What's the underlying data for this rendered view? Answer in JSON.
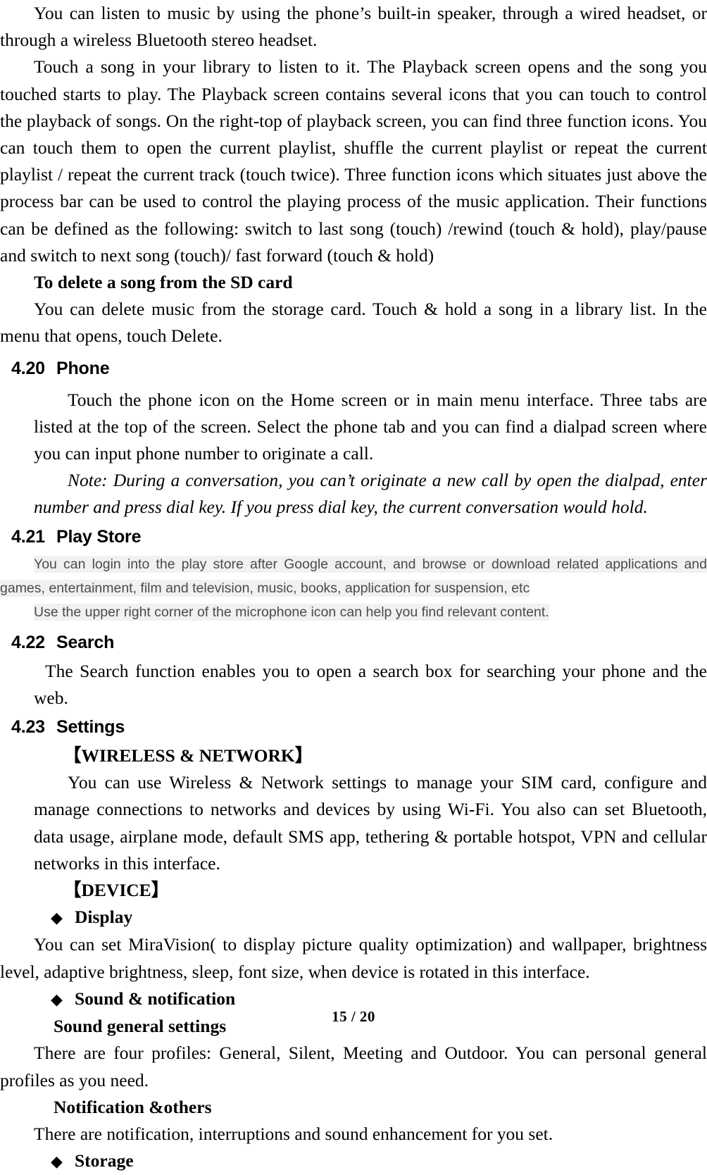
{
  "document": {
    "page_label": "15 / 20",
    "page_number": "15",
    "total_pages": "20"
  },
  "body": {
    "music_para_1": "You can listen to music by using the phone’s built-in speaker, through a wired headset, or through a wireless Bluetooth stereo headset.",
    "music_para_2": "Touch a song in your library to listen to it. The Playback screen opens and the song you touched starts to play. The Playback screen contains several icons that you can touch to control the playback of songs. On the right-top of playback screen, you can find three function icons. You can touch them to open the current playlist, shuffle the current playlist or repeat the current playlist / repeat the current track (touch twice). Three function icons which situates just above the process bar can be used to control the playing process of the music application. Their functions can be defined as the following: switch to last song (touch) /rewind (touch & hold), play/pause and switch to next song (touch)/ fast forward (touch & hold)",
    "delete_song_heading": "To delete a song from the SD card",
    "delete_song_para": "You can delete music from the storage card. Touch & hold a song in a library list. In the menu that opens, touch Delete."
  },
  "sections": [
    {
      "number": "4.20",
      "title": "Phone",
      "paragraph": "Touch the phone icon on the Home screen or in main menu interface. Three tabs are listed at the top of the screen. Select the phone tab and you can find a dialpad screen where you can input phone number to originate a call.",
      "note": "Note: During a conversation, you can’t originate a new call by open the dialpad, enter number and press dial key. If you press dial key, the current conversation would hold."
    },
    {
      "number": "4.21",
      "title": "Play Store",
      "paragraph_1": "You can login into the play store after Google account, and browse or download related applications and games, entertainment, film and television, music, books, application for suspension, etc",
      "paragraph_2": "Use the upper right corner of the microphone icon can help you find relevant content.",
      "highlight_color": "#f1f1f1",
      "text_color": "#4a4a4a"
    },
    {
      "number": "4.22",
      "title": "Search",
      "paragraph": "The Search function enables you to open a search box for searching your phone and the web."
    },
    {
      "number": "4.23",
      "title": "Settings",
      "wireless_heading": "【WIRELESS & NETWORK】",
      "wireless_para": "You can use Wireless & Network settings to manage your SIM card, configure and manage connections to networks and devices by using Wi-Fi. You also can set Bluetooth, data usage, airplane mode, default SMS app, tethering & portable hotspot, VPN and cellular networks in this interface.",
      "device_heading": "【DEVICE】",
      "bullet_glyph": "◆",
      "items": [
        {
          "label": "Display",
          "paragraph": "You can set MiraVision( to display picture quality optimization) and wallpaper, brightness level, adaptive brightness, sleep, font size, when device is rotated in this interface."
        },
        {
          "label": "Sound & notification",
          "sub_heading_1": "Sound general settings",
          "sub_para_1": "There are four profiles: General, Silent, Meeting and Outdoor. You can personal general profiles as you need.",
          "sub_heading_2": "Notification &others",
          "sub_para_2": "There are notification, interruptions and sound enhancement for you set."
        },
        {
          "label": "Storage"
        }
      ]
    }
  ]
}
